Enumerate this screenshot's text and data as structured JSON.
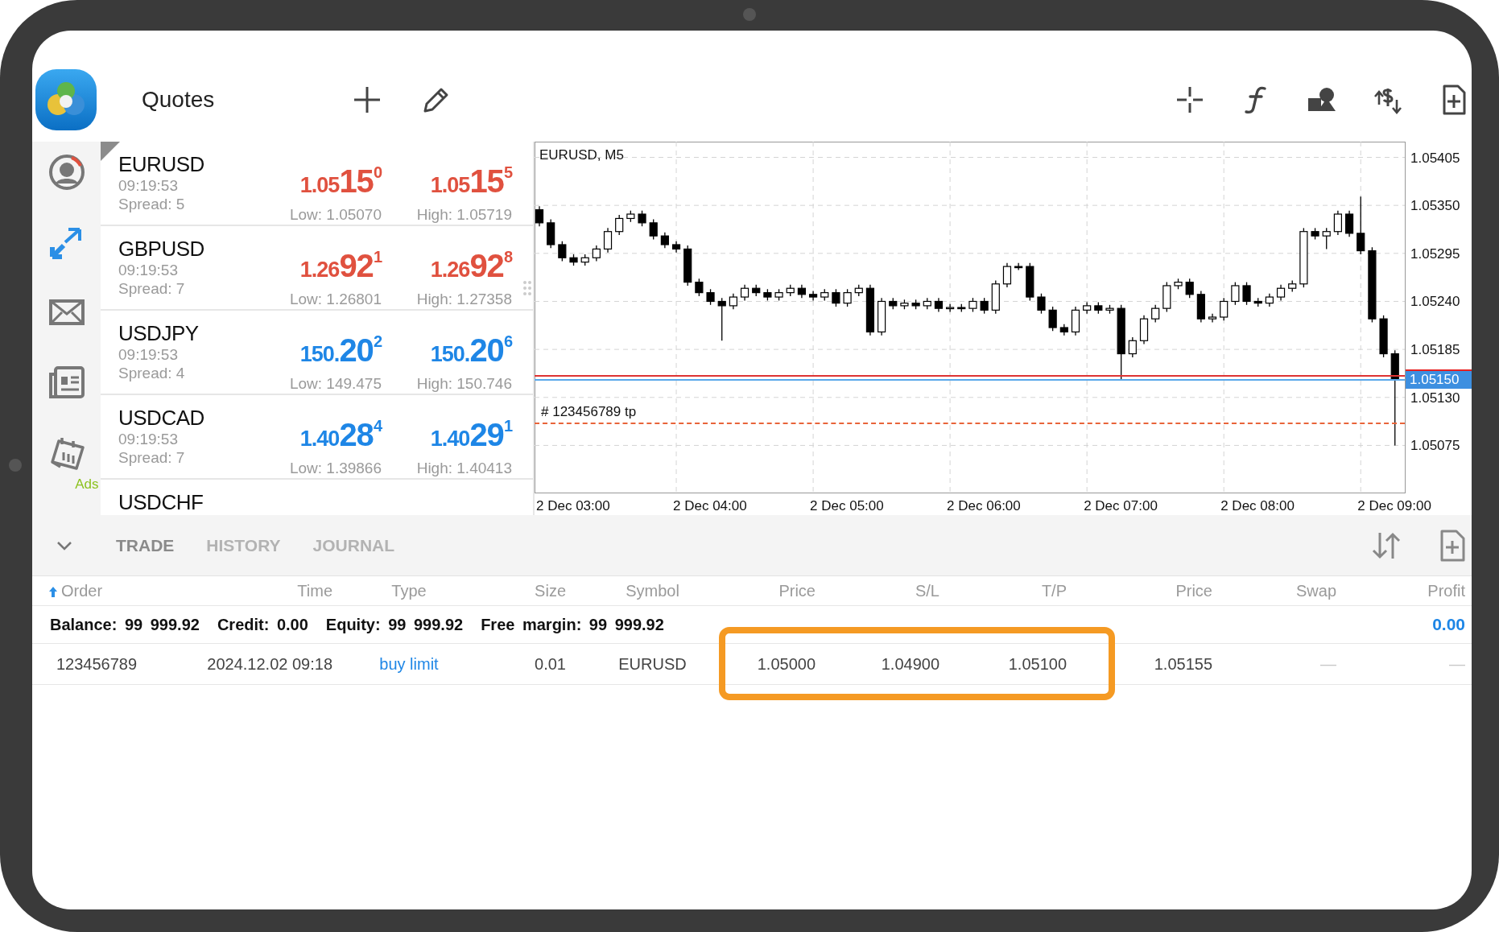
{
  "toolbar": {
    "title": "Quotes"
  },
  "sidebar": {
    "items": [
      {
        "kind": "account",
        "selected": false
      },
      {
        "kind": "trade",
        "selected": true
      },
      {
        "kind": "mail",
        "selected": false
      },
      {
        "kind": "news",
        "selected": false
      },
      {
        "kind": "calendar",
        "selected": false,
        "badge": "Ads"
      }
    ]
  },
  "quotes": [
    {
      "symbol": "EURUSD",
      "time": "09:19:53",
      "spread": "Spread: 5",
      "color": "#e0513f",
      "selected": true,
      "bid": {
        "lead": "1.05",
        "big": "15",
        "pip": "0"
      },
      "ask": {
        "lead": "1.05",
        "big": "15",
        "pip": "5"
      },
      "low": "Low: 1.05070",
      "high": "High: 1.05719"
    },
    {
      "symbol": "GBPUSD",
      "time": "09:19:53",
      "spread": "Spread: 7",
      "color": "#e0513f",
      "selected": false,
      "bid": {
        "lead": "1.26",
        "big": "92",
        "pip": "1"
      },
      "ask": {
        "lead": "1.26",
        "big": "92",
        "pip": "8"
      },
      "low": "Low: 1.26801",
      "high": "High: 1.27358"
    },
    {
      "symbol": "USDJPY",
      "time": "09:19:53",
      "spread": "Spread: 4",
      "color": "#1e86e6",
      "selected": false,
      "bid": {
        "lead": "150.",
        "big": "20",
        "pip": "2"
      },
      "ask": {
        "lead": "150.",
        "big": "20",
        "pip": "6"
      },
      "low": "Low: 149.475",
      "high": "High: 150.746"
    },
    {
      "symbol": "USDCAD",
      "time": "09:19:53",
      "spread": "Spread: 7",
      "color": "#1e86e6",
      "selected": false,
      "bid": {
        "lead": "1.40",
        "big": "28",
        "pip": "4"
      },
      "ask": {
        "lead": "1.40",
        "big": "29",
        "pip": "1"
      },
      "low": "Low: 1.39866",
      "high": "High: 1.40413"
    },
    {
      "symbol": "USDCHF",
      "selected": false
    }
  ],
  "chart": {
    "price_lines": [
      {
        "kind": "ask"
      },
      {
        "kind": "bid",
        "label": "1.05150"
      },
      {
        "kind": "take_profit",
        "label": "# 123456789  tp"
      }
    ],
    "time_labels": [
      "2 Dec 03:00",
      "2 Dec 04:00",
      "2 Dec 05:00",
      "2 Dec 06:00",
      "2 Dec 07:00",
      "2 Dec 08:00",
      "2 Dec 09:00"
    ],
    "chart_data": {
      "type": "candlestick",
      "title": "EURUSD, M5",
      "grid": true,
      "ylim": [
        1.05021,
        1.05423
      ],
      "yticks": [
        {
          "value": 1.05405,
          "label": "1.05405"
        },
        {
          "value": 1.0535,
          "label": "1.05350"
        },
        {
          "value": 1.05295,
          "label": "1.05295"
        },
        {
          "value": 1.0524,
          "label": "1.05240"
        },
        {
          "value": 1.05185,
          "label": "1.05185"
        },
        {
          "value": 1.0513,
          "label": "1.05130"
        },
        {
          "value": 1.05075,
          "label": "1.05075"
        }
      ],
      "ohlc": [
        [
          1.05345,
          1.05349,
          1.05326,
          1.0533
        ],
        [
          1.0533,
          1.05334,
          1.05301,
          1.05305
        ],
        [
          1.05305,
          1.05309,
          1.05286,
          1.0529
        ],
        [
          1.0529,
          1.05294,
          1.05281,
          1.05285
        ],
        [
          1.05285,
          1.05294,
          1.05281,
          1.0529
        ],
        [
          1.0529,
          1.05304,
          1.05286,
          1.053
        ],
        [
          1.053,
          1.05324,
          1.05296,
          1.0532
        ],
        [
          1.0532,
          1.05339,
          1.05316,
          1.05335
        ],
        [
          1.05335,
          1.05344,
          1.05331,
          1.0534
        ],
        [
          1.0534,
          1.05344,
          1.05326,
          1.0533
        ],
        [
          1.0533,
          1.05334,
          1.05311,
          1.05315
        ],
        [
          1.05315,
          1.05319,
          1.05301,
          1.05305
        ],
        [
          1.05305,
          1.05309,
          1.05296,
          1.053
        ],
        [
          1.053,
          1.05304,
          1.05258,
          1.05262
        ],
        [
          1.05262,
          1.05266,
          1.05246,
          1.0525
        ],
        [
          1.0525,
          1.05254,
          1.05236,
          1.0524
        ],
        [
          1.0524,
          1.05244,
          1.05195,
          1.05235
        ],
        [
          1.05235,
          1.05249,
          1.05231,
          1.05245
        ],
        [
          1.05245,
          1.05259,
          1.05241,
          1.05255
        ],
        [
          1.05255,
          1.05259,
          1.05246,
          1.0525
        ],
        [
          1.0525,
          1.05254,
          1.05241,
          1.05245
        ],
        [
          1.05245,
          1.05254,
          1.05241,
          1.0525
        ],
        [
          1.0525,
          1.05259,
          1.05246,
          1.05255
        ],
        [
          1.05255,
          1.05259,
          1.05244,
          1.05248
        ],
        [
          1.05248,
          1.05252,
          1.05241,
          1.05245
        ],
        [
          1.05245,
          1.05254,
          1.05241,
          1.0525
        ],
        [
          1.0525,
          1.05254,
          1.05234,
          1.05238
        ],
        [
          1.05238,
          1.05254,
          1.05234,
          1.0525
        ],
        [
          1.0525,
          1.05259,
          1.05246,
          1.05255
        ],
        [
          1.05255,
          1.05259,
          1.05201,
          1.05205
        ],
        [
          1.05205,
          1.05244,
          1.05201,
          1.0524
        ],
        [
          1.0524,
          1.05244,
          1.05231,
          1.05235
        ],
        [
          1.05235,
          1.05242,
          1.05231,
          1.05238
        ],
        [
          1.05238,
          1.05242,
          1.05231,
          1.05235
        ],
        [
          1.05235,
          1.05244,
          1.05231,
          1.0524
        ],
        [
          1.0524,
          1.05244,
          1.05228,
          1.05232
        ],
        [
          1.05232,
          1.05237,
          1.05228,
          1.05233
        ],
        [
          1.05233,
          1.05237,
          1.05228,
          1.05232
        ],
        [
          1.05232,
          1.05244,
          1.05228,
          1.0524
        ],
        [
          1.0524,
          1.05244,
          1.05226,
          1.0523
        ],
        [
          1.0523,
          1.05264,
          1.05226,
          1.0526
        ],
        [
          1.0526,
          1.05284,
          1.05256,
          1.0528
        ],
        [
          1.0528,
          1.05284,
          1.05276,
          1.0528
        ],
        [
          1.0528,
          1.05284,
          1.05241,
          1.05245
        ],
        [
          1.05245,
          1.05249,
          1.05226,
          1.0523
        ],
        [
          1.0523,
          1.05234,
          1.05206,
          1.0521
        ],
        [
          1.0521,
          1.05214,
          1.05201,
          1.05205
        ],
        [
          1.05205,
          1.05234,
          1.05201,
          1.0523
        ],
        [
          1.0523,
          1.05239,
          1.05226,
          1.05235
        ],
        [
          1.05235,
          1.05239,
          1.05226,
          1.0523
        ],
        [
          1.0523,
          1.05236,
          1.05226,
          1.05232
        ],
        [
          1.05232,
          1.05236,
          1.0515,
          1.0518
        ],
        [
          1.0518,
          1.05199,
          1.05176,
          1.05195
        ],
        [
          1.05195,
          1.05224,
          1.05191,
          1.0522
        ],
        [
          1.0522,
          1.05236,
          1.05216,
          1.05232
        ],
        [
          1.05232,
          1.05262,
          1.05228,
          1.05258
        ],
        [
          1.05258,
          1.05266,
          1.05254,
          1.05262
        ],
        [
          1.05262,
          1.05266,
          1.05244,
          1.05248
        ],
        [
          1.05248,
          1.05252,
          1.05216,
          1.0522
        ],
        [
          1.0522,
          1.05226,
          1.05216,
          1.05222
        ],
        [
          1.05222,
          1.05244,
          1.05218,
          1.0524
        ],
        [
          1.0524,
          1.05262,
          1.05236,
          1.05258
        ],
        [
          1.05258,
          1.05262,
          1.05236,
          1.0524
        ],
        [
          1.0524,
          1.05244,
          1.05234,
          1.05238
        ],
        [
          1.05238,
          1.05249,
          1.05234,
          1.05245
        ],
        [
          1.05245,
          1.05259,
          1.05241,
          1.05255
        ],
        [
          1.05255,
          1.05264,
          1.05251,
          1.0526
        ],
        [
          1.0526,
          1.05324,
          1.05256,
          1.0532
        ],
        [
          1.0532,
          1.05324,
          1.05311,
          1.05315
        ],
        [
          1.05315,
          1.05324,
          1.053,
          1.0532
        ],
        [
          1.0532,
          1.05344,
          1.05316,
          1.0534
        ],
        [
          1.0534,
          1.05344,
          1.05314,
          1.05318
        ],
        [
          1.05318,
          1.0536,
          1.05294,
          1.05298
        ],
        [
          1.05298,
          1.05302,
          1.05216,
          1.0522
        ],
        [
          1.0522,
          1.05224,
          1.05176,
          1.0518
        ],
        [
          1.0518,
          1.05184,
          1.05075,
          1.0515
        ]
      ]
    }
  },
  "tabs": [
    {
      "label": "TRADE",
      "selected": true
    },
    {
      "label": "HISTORY",
      "selected": false
    },
    {
      "label": "JOURNAL",
      "selected": false
    }
  ],
  "trade": {
    "columns": [
      "Order",
      "Time",
      "Type",
      "Size",
      "Symbol",
      "Price",
      "S/L",
      "T/P",
      "Price",
      "Swap",
      "Profit"
    ],
    "summary": [
      {
        "label": "Balance:",
        "value": "99 999.92"
      },
      {
        "label": "Credit:",
        "value": "0.00"
      },
      {
        "label": "Equity:",
        "value": "99 999.92"
      },
      {
        "label": "Free margin:",
        "value": "99 999.92"
      }
    ],
    "total_profit": "0.00",
    "orders": [
      {
        "order": "123456789",
        "time": "2024.12.02 09:18",
        "type": "buy limit",
        "size": "0.01",
        "symbol": "EURUSD",
        "price": "1.05000",
        "sl": "1.04900",
        "tp": "1.05100",
        "current": "1.05155",
        "swap": "—",
        "profit": "—",
        "highlight": true
      }
    ]
  }
}
